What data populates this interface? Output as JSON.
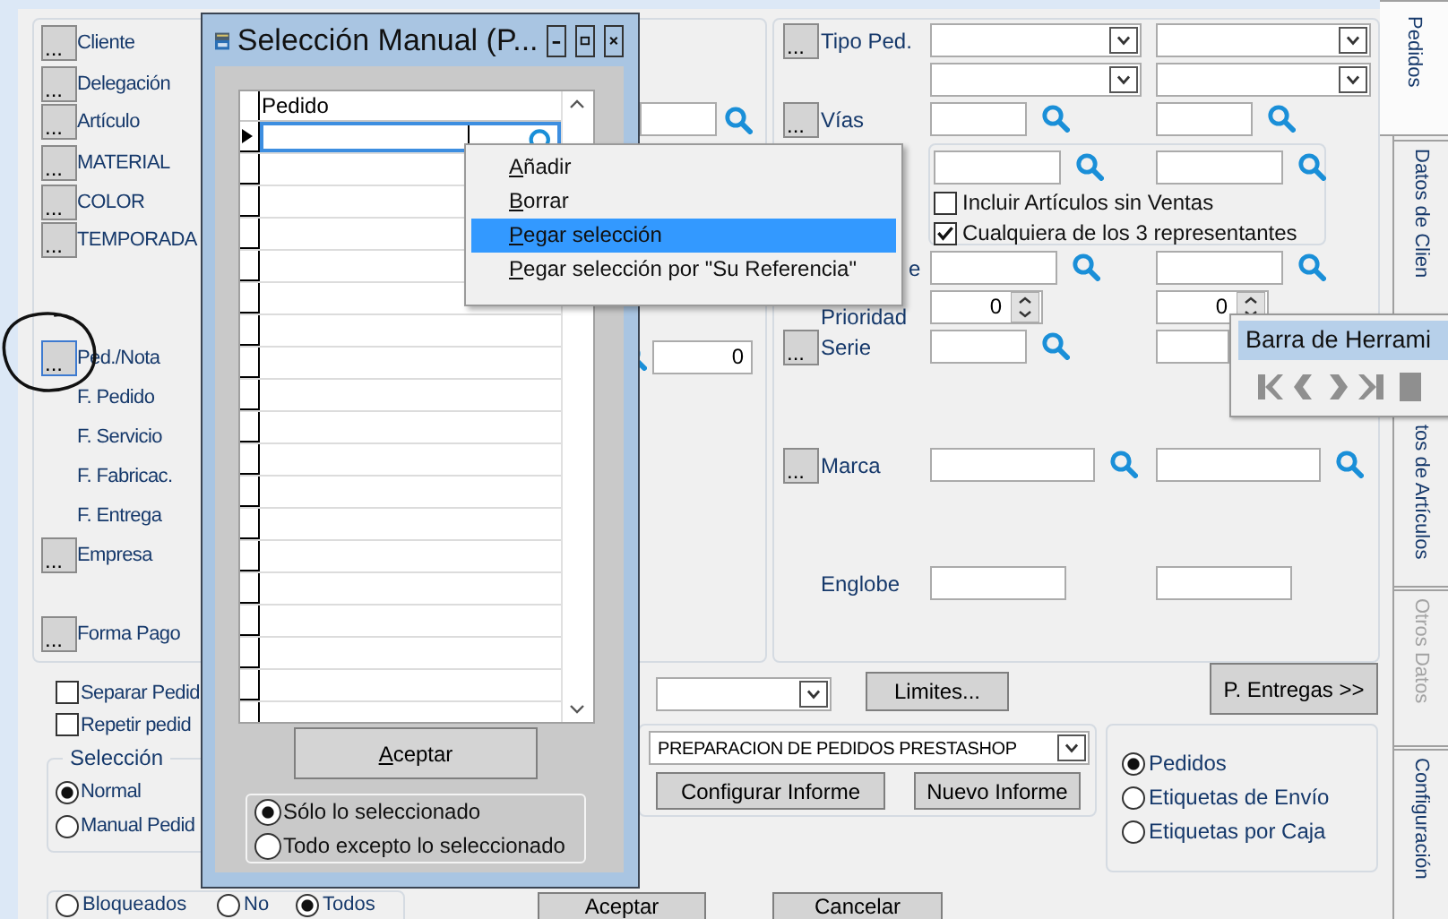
{
  "main_window": {
    "left_filters": [
      {
        "button": "...",
        "label": "Cliente",
        "focused": false
      },
      {
        "button": "...",
        "label": "Delegación",
        "focused": false
      },
      {
        "button": "...",
        "label": "Artículo",
        "focused": false
      },
      {
        "button": "...",
        "label": "MATERIAL",
        "focused": false
      },
      {
        "button": "...",
        "label": "COLOR",
        "focused": false
      },
      {
        "button": "...",
        "label": "TEMPORADA",
        "focused": false
      },
      {
        "button": "...",
        "label": "Ped./Nota",
        "focused": true
      },
      {
        "label": "F. Pedido"
      },
      {
        "label": "F. Servicio"
      },
      {
        "label": "F. Fabricac."
      },
      {
        "label": "F. Entrega"
      },
      {
        "button": "...",
        "label": "Empresa",
        "focused": false
      },
      {
        "button": "...",
        "label": "Forma Pago",
        "focused": false
      }
    ],
    "annotation": {
      "kind": "hand_drawn_circle"
    },
    "middle_fields": [
      {
        "kind": "search"
      },
      {
        "kind": "number",
        "value": "0"
      }
    ],
    "right_filters": [
      {
        "kind": "combo_pair",
        "button": "...",
        "label": "Tipo Ped."
      },
      {
        "kind": "combo_pair"
      },
      {
        "kind": "search_pair",
        "button": "...",
        "label": "Vías"
      },
      {
        "kind": "search_pair"
      },
      {
        "kind": "checkbox",
        "label": "Incluir Artículos sin Ventas",
        "checked": false
      },
      {
        "kind": "checkbox",
        "label": "Cualquiera de los 3 representantes",
        "checked": true
      },
      {
        "kind": "search_pair",
        "label": "e"
      },
      {
        "kind": "spin_pair",
        "label": "Prioridad",
        "values": [
          "0",
          "0"
        ]
      },
      {
        "kind": "search_pair",
        "button": "...",
        "label": "Serie"
      },
      {
        "kind": "search_pair",
        "button": "...",
        "label": "Marca"
      },
      {
        "kind": "text_pair",
        "label": "Englobe"
      }
    ],
    "limits_button": "Limites...",
    "deliveries_button": "P. Entregas >>",
    "report": {
      "value": "PREPARACION DE PEDIDOS PRESTASHOP",
      "buttons": [
        "Configurar Informe",
        "Nuevo Informe"
      ]
    },
    "output_type": [
      {
        "label": "Pedidos",
        "selected": true
      },
      {
        "label": "Etiquetas de Envío",
        "selected": false
      },
      {
        "label": "Etiquetas por Caja",
        "selected": false
      }
    ],
    "left_options": [
      {
        "label": "Separar Pedid",
        "checked": false
      },
      {
        "label": "Repetir pedid",
        "checked": false
      }
    ],
    "selection": {
      "title": "Selección",
      "options": [
        {
          "label": "Normal",
          "selected": true
        },
        {
          "label": "Manual Pedid",
          "selected": false
        }
      ]
    },
    "blocked_filter": [
      {
        "label": "Bloqueados",
        "selected": false
      },
      {
        "label": "No",
        "selected": false
      },
      {
        "label": "Todos",
        "selected": true
      }
    ],
    "footer_buttons": [
      "Aceptar",
      "Cancelar"
    ],
    "side_tabs": [
      {
        "label": "Pedidos",
        "selected": true,
        "disabled": false
      },
      {
        "label": "Datos de Clien",
        "selected": false,
        "disabled": false
      },
      {
        "label": "tos de Artículos",
        "selected": false,
        "disabled": false
      },
      {
        "label": "Otros Datos",
        "selected": false,
        "disabled": true
      },
      {
        "label": "Configuración",
        "selected": false,
        "disabled": false
      }
    ]
  },
  "dialog": {
    "title": "Selección Manual (P...",
    "grid": {
      "column": "Pedido"
    },
    "accept_button": "Aceptar",
    "scope": [
      {
        "label": "Sólo lo seleccionado",
        "selected": true
      },
      {
        "label": "Todo excepto lo seleccionado",
        "selected": false
      }
    ]
  },
  "context_menu": [
    {
      "label": "Añadir",
      "selected": false
    },
    {
      "label": "Borrar",
      "selected": false
    },
    {
      "label": "Pegar selección",
      "selected": true
    },
    {
      "label": "Pegar selección por \"Su Referencia\"",
      "selected": false
    }
  ],
  "toolbar": {
    "title": "Barra de Herrami"
  }
}
